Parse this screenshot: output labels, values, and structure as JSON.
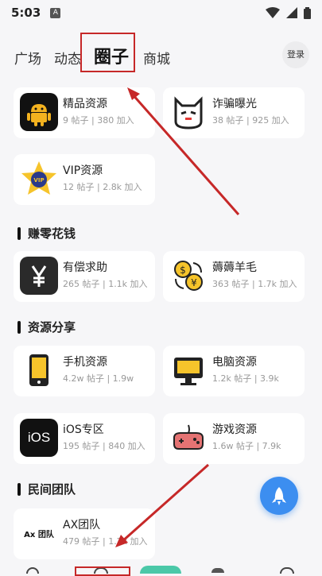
{
  "status_bar": {
    "time": "5:03",
    "notification_badge": "A"
  },
  "top_tabs": [
    {
      "label": "广场"
    },
    {
      "label": "动态"
    },
    {
      "label": "圈子",
      "active": true
    },
    {
      "label": "商城"
    }
  ],
  "login_label": "登录",
  "featured": [
    {
      "name": "精品资源",
      "meta": "9 帖子 | 380 加入",
      "icon": "android-icon"
    },
    {
      "name": "诈骗曝光",
      "meta": "38 帖子 | 925 加入",
      "icon": "ghost-mask-icon"
    },
    {
      "name": "VIP资源",
      "meta": "12 帖子 | 2.8k 加入",
      "icon": "vip-star-icon"
    }
  ],
  "sections": [
    {
      "title": "赚零花钱",
      "cards": [
        {
          "name": "有偿求助",
          "meta": "265 帖子 | 1.1k 加入",
          "icon": "yen-icon"
        },
        {
          "name": "薅薅羊毛",
          "meta": "363 帖子 | 1.7k 加入",
          "icon": "currency-exchange-icon"
        }
      ]
    },
    {
      "title": "资源分享",
      "cards": [
        {
          "name": "手机资源",
          "meta": "4.2w 帖子 | 1.9w",
          "icon": "phone-icon"
        },
        {
          "name": "电脑资源",
          "meta": "1.2k 帖子 | 3.9k",
          "icon": "monitor-icon"
        },
        {
          "name": "iOS专区",
          "meta": "195 帖子 | 840 加入",
          "icon": "ios-icon",
          "icon_text": "iOS"
        },
        {
          "name": "游戏资源",
          "meta": "1.6w 帖子 | 7.9k",
          "icon": "gamepad-icon"
        }
      ]
    },
    {
      "title": "民间团队",
      "cards": [
        {
          "name": "AX团队",
          "meta": "479 帖子 | 1.2k 加入",
          "icon": "ax-team-logo",
          "icon_text": "Ax 团队"
        }
      ]
    }
  ],
  "colors": {
    "accent": "#3c8ef0",
    "annotation": "#c62828"
  }
}
